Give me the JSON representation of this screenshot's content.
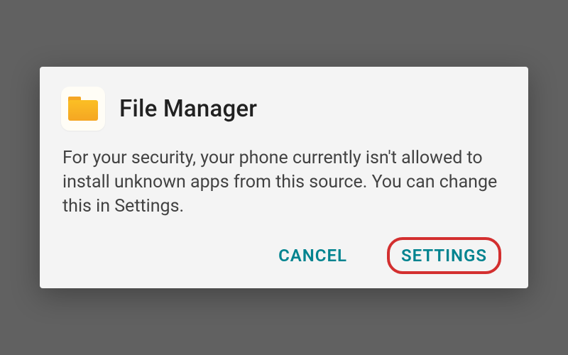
{
  "dialog": {
    "app_name": "File Manager",
    "icon": "folder-icon",
    "message": "For your security, your phone currently isn't allowed to install unknown apps from this source. You can change this in Settings.",
    "actions": {
      "cancel": "CANCEL",
      "settings": "SETTINGS"
    },
    "colors": {
      "accent": "#00838f",
      "highlight": "#d32f2f",
      "folder": "#f5a623"
    }
  }
}
